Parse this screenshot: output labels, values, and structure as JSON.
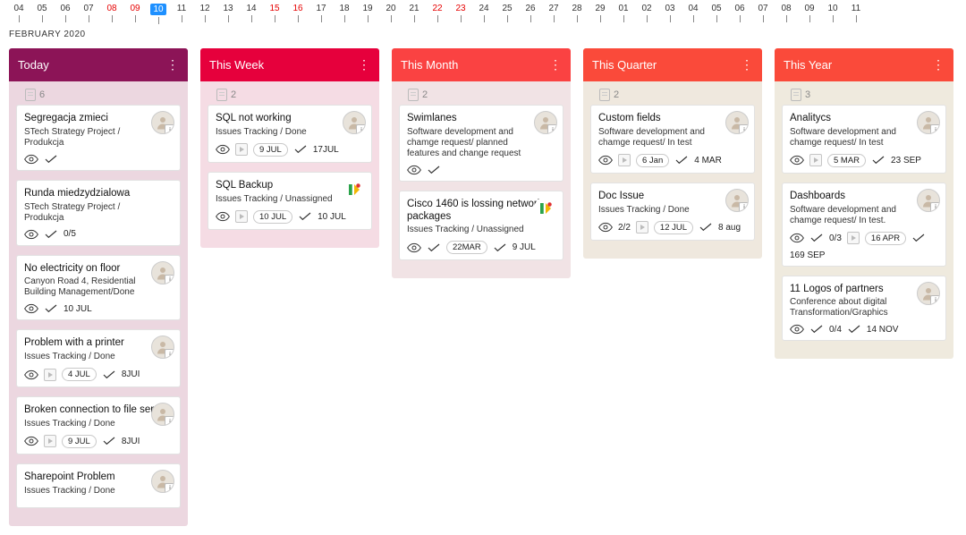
{
  "monthLabel": "FEBRUARY 2020",
  "ruler": [
    {
      "d": "04",
      "w": false,
      "t": false
    },
    {
      "d": "05",
      "w": false,
      "t": false
    },
    {
      "d": "06",
      "w": false,
      "t": false
    },
    {
      "d": "07",
      "w": false,
      "t": false
    },
    {
      "d": "08",
      "w": true,
      "t": false
    },
    {
      "d": "09",
      "w": true,
      "t": false
    },
    {
      "d": "10",
      "w": false,
      "t": true
    },
    {
      "d": "11",
      "w": false,
      "t": false
    },
    {
      "d": "12",
      "w": false,
      "t": false
    },
    {
      "d": "13",
      "w": false,
      "t": false
    },
    {
      "d": "14",
      "w": false,
      "t": false
    },
    {
      "d": "15",
      "w": true,
      "t": false
    },
    {
      "d": "16",
      "w": true,
      "t": false
    },
    {
      "d": "17",
      "w": false,
      "t": false
    },
    {
      "d": "18",
      "w": false,
      "t": false
    },
    {
      "d": "19",
      "w": false,
      "t": false
    },
    {
      "d": "20",
      "w": false,
      "t": false
    },
    {
      "d": "21",
      "w": false,
      "t": false
    },
    {
      "d": "22",
      "w": true,
      "t": false
    },
    {
      "d": "23",
      "w": true,
      "t": false
    },
    {
      "d": "24",
      "w": false,
      "t": false
    },
    {
      "d": "25",
      "w": false,
      "t": false
    },
    {
      "d": "26",
      "w": false,
      "t": false
    },
    {
      "d": "27",
      "w": false,
      "t": false
    },
    {
      "d": "28",
      "w": false,
      "t": false
    },
    {
      "d": "29",
      "w": false,
      "t": false
    },
    {
      "d": "01",
      "w": false,
      "t": false
    },
    {
      "d": "02",
      "w": false,
      "t": false
    },
    {
      "d": "03",
      "w": false,
      "t": false
    },
    {
      "d": "04",
      "w": false,
      "t": false
    },
    {
      "d": "05",
      "w": false,
      "t": false
    },
    {
      "d": "06",
      "w": false,
      "t": false
    },
    {
      "d": "07",
      "w": false,
      "t": false
    },
    {
      "d": "08",
      "w": false,
      "t": false
    },
    {
      "d": "09",
      "w": false,
      "t": false
    },
    {
      "d": "10",
      "w": false,
      "t": false
    },
    {
      "d": "11",
      "w": false,
      "t": false
    }
  ],
  "columns": [
    {
      "id": "today",
      "title": "Today",
      "count": "6",
      "headClass": "bg-today-head",
      "bodyClass": "bg-today-body",
      "cards": [
        {
          "title": "Segregacja zmieci",
          "sub": "STech Strategy Project / Produkcja",
          "avatar": "person",
          "eye": true,
          "check": true
        },
        {
          "title": "Runda miedzydzialowa",
          "sub": "STech Strategy Project / Produkcja",
          "eye": true,
          "check": true,
          "ratio": "0/5"
        },
        {
          "title": "No electricity on floor",
          "sub": "Canyon Road 4, Residential Building Management/Done",
          "avatar": "person",
          "eye": true,
          "check": true,
          "date2": "10 JUL"
        },
        {
          "title": "Problem with a printer",
          "sub": "Issues Tracking / Done",
          "avatar": "person",
          "eye": true,
          "play": true,
          "pill": "4 JUL",
          "check2": true,
          "date2": "8JUI"
        },
        {
          "title": "Broken connection to file server",
          "sub": "Issues Tracking / Done",
          "avatar": "person",
          "eye": true,
          "play": true,
          "pill": "9 JUL",
          "check2": true,
          "date2": "8JUI"
        },
        {
          "title": "Sharepoint Problem",
          "sub": "Issues Tracking / Done",
          "avatar": "person"
        }
      ]
    },
    {
      "id": "week",
      "title": "This Week",
      "count": "2",
      "headClass": "bg-week-head",
      "bodyClass": "bg-week-body",
      "cards": [
        {
          "title": "SQL not working",
          "sub": "Issues Tracking / Done",
          "avatar": "person",
          "eye": true,
          "play": true,
          "pill": "9 JUL",
          "check2": true,
          "date2": "17JUL"
        },
        {
          "title": "SQL Backup",
          "sub": "Issues Tracking / Unassigned",
          "logo": "k",
          "eye": true,
          "play": true,
          "pill": "10 JUL",
          "check2": true,
          "date2": "10 JUL"
        }
      ]
    },
    {
      "id": "month",
      "title": "This Month",
      "count": "2",
      "headClass": "bg-month-head",
      "bodyClass": "bg-month-body",
      "cards": [
        {
          "title": "Swimlanes",
          "sub": "Software development and chamge request/ planned features and change request",
          "avatar": "person",
          "eye": true,
          "check": true
        },
        {
          "title": "Cisco 1460 is lossing network packages",
          "sub": "Issues Tracking / Unassigned",
          "logo": "k",
          "eye": true,
          "check": true,
          "pill": "22MAR",
          "check2": true,
          "date2": "9 JUL"
        }
      ]
    },
    {
      "id": "quarter",
      "title": "This Quarter",
      "count": "2",
      "headClass": "bg-quarter-head",
      "bodyClass": "bg-quarter-body",
      "cards": [
        {
          "title": "Custom fields",
          "sub": "Software development and chamge request/   In test",
          "avatar": "person",
          "eye": true,
          "play": true,
          "pill": "6 Jan",
          "check2": true,
          "date2": "4 MAR"
        },
        {
          "title": "Doc Issue",
          "sub": "Issues Tracking / Done",
          "avatar": "person",
          "eye": true,
          "ratio": "2/2",
          "play": true,
          "pill": "12 JUL",
          "check2": true,
          "date2": "8 aug"
        }
      ]
    },
    {
      "id": "year",
      "title": "This Year",
      "count": "3",
      "headClass": "bg-year-head",
      "bodyClass": "bg-year-body",
      "cards": [
        {
          "title": "Analitycs",
          "sub": "Software development and chamge request/   In test",
          "avatar": "person",
          "eye": true,
          "play": true,
          "pill": "5 MAR",
          "check2": true,
          "date2": "23 SEP"
        },
        {
          "title": "Dashboards",
          "sub": "Software development and chamge request/ In test.",
          "avatar": "person",
          "eye": true,
          "check": true,
          "ratio": "0/3",
          "play": true,
          "pill": "16 APR",
          "check2": true,
          "date2": "169 SEP"
        },
        {
          "title": "11 Logos of partners",
          "sub": "Conference about digital Transformation/Graphics",
          "avatar": "person",
          "eye": true,
          "check": true,
          "ratio": "0/4",
          "check2": true,
          "date2": "14 NOV"
        }
      ]
    }
  ]
}
